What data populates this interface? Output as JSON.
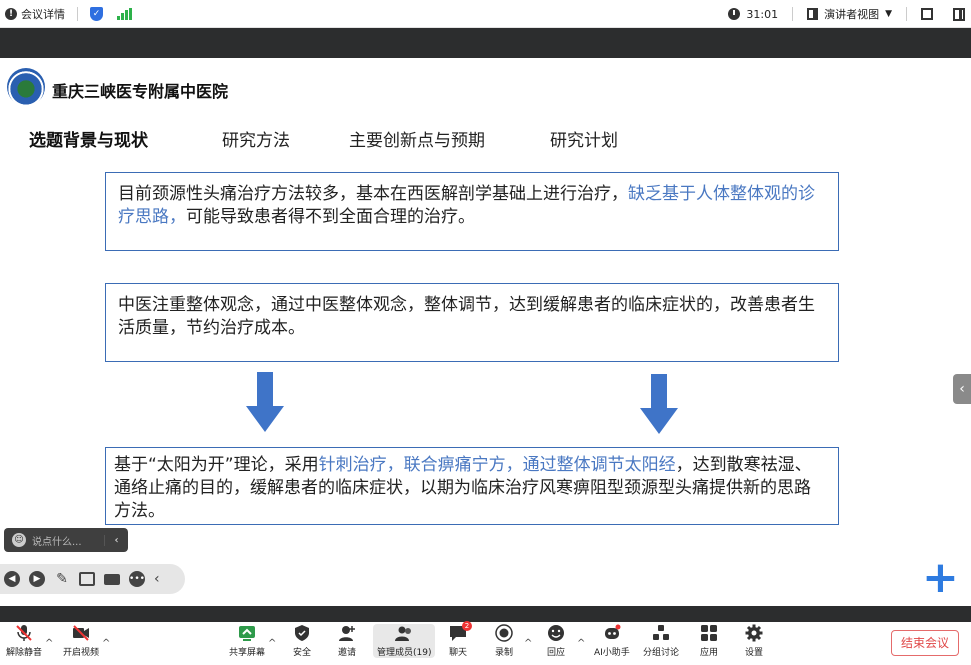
{
  "topbar": {
    "meeting_details": "会议详情",
    "timer": "31:01",
    "view_mode": "演讲者视图"
  },
  "slide": {
    "hospital_name": "重庆三峡医专附属中医院",
    "tabs": [
      "选题背景与现状",
      "研究方法",
      "主要创新点与预期",
      "研究计划"
    ],
    "box1": {
      "text_a": "目前颈源性头痛治疗方法较多，基本在西医解剖学基础上进行治疗，",
      "highlight": "缺乏基于人体整体观的诊疗思路，",
      "text_b": "可能导致患者得不到全面合理的治疗。"
    },
    "box2": {
      "text": "中医注重整体观念，通过中医整体观念，整体调节，达到缓解患者的临床症状的，改善患者生活质量，节约治疗成本。"
    },
    "box3": {
      "text_a": "基于“太阳为开”理论，采用",
      "highlight": "针刺治疗，联合痹痛宁方，通过整体调节太阳经",
      "text_b": "，达到散寒祛湿、通络止痛的目的，缓解患者的临床症状，以期为临床治疗风寒痹阻型颈源型头痛提供新的思路方法。"
    }
  },
  "comment": {
    "placeholder": "说点什么..."
  },
  "toolbar": {
    "unmute": "解除静音",
    "start_video": "开启视频",
    "share_screen": "共享屏幕",
    "security": "安全",
    "invite": "邀请",
    "manage_members": "管理成员(19)",
    "chat": "聊天",
    "chat_badge": "2",
    "record": "录制",
    "reaction": "回应",
    "ai_assistant": "AI小助手",
    "breakout": "分组讨论",
    "apps": "应用",
    "settings": "设置",
    "end_meeting": "结束会议"
  },
  "colors": {
    "accent": "#2e7be0",
    "box_border": "#3b6cb5",
    "highlight": "#4a78c2",
    "end": "#e04848"
  }
}
